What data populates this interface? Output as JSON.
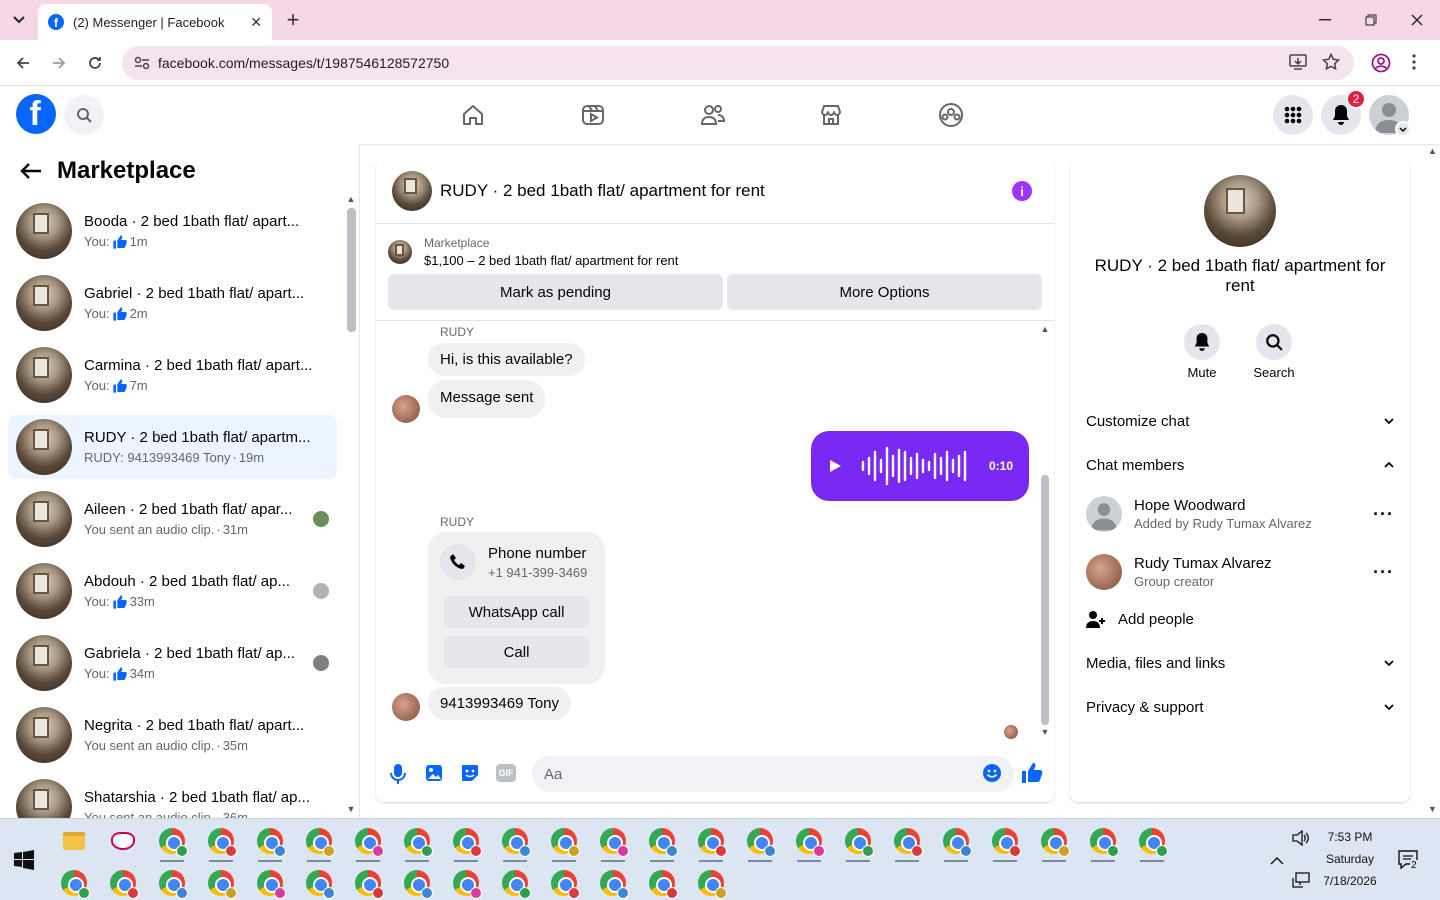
{
  "browser": {
    "tab_title": "(2) Messenger | Facebook",
    "tab_close": "✕",
    "new_tab": "+",
    "url": "facebook.com/messages/t/1987546128572750"
  },
  "fb_header": {
    "notification_count": "2"
  },
  "sidebar": {
    "title": "Marketplace",
    "conversations": [
      {
        "name": "Booda · 2 bed 1bath flat/ apart...",
        "prefix": "You:",
        "like": true,
        "time": "1m",
        "preview": "",
        "active": false
      },
      {
        "name": "Gabriel · 2 bed 1bath flat/ apart...",
        "prefix": "You:",
        "like": true,
        "time": "2m",
        "preview": "",
        "active": false
      },
      {
        "name": "Carmina · 2 bed 1bath flat/ apart...",
        "prefix": "You:",
        "like": true,
        "time": "7m",
        "preview": "",
        "active": false
      },
      {
        "name": "RUDY · 2 bed 1bath flat/ apartm...",
        "prefix": "",
        "like": false,
        "time": "19m",
        "preview": "RUDY: 9413993469 Tony",
        "active": true
      },
      {
        "name": "Aileen · 2 bed 1bath flat/ apar...",
        "prefix": "",
        "like": false,
        "time": "31m",
        "preview": "You sent an audio clip.",
        "active": false
      },
      {
        "name": "Abdouh · 2 bed 1bath flat/ ap...",
        "prefix": "You:",
        "like": true,
        "time": "33m",
        "preview": "",
        "active": false
      },
      {
        "name": "Gabriela · 2 bed 1bath flat/ ap...",
        "prefix": "You:",
        "like": true,
        "time": "34m",
        "preview": "",
        "active": false
      },
      {
        "name": "Negrita · 2 bed 1bath flat/ apart...",
        "prefix": "",
        "like": false,
        "time": "35m",
        "preview": "You sent an audio clip.",
        "active": false
      },
      {
        "name": "Shatarshia · 2 bed 1bath flat/ ap...",
        "prefix": "",
        "like": false,
        "time": "36m",
        "preview": "You sent an audio clip.",
        "active": false
      }
    ]
  },
  "chat": {
    "title": "RUDY · 2 bed 1bath flat/ apartment for rent",
    "marketplace_label": "Marketplace",
    "listing": "$1,100 – 2 bed 1bath flat/ apartment for rent",
    "mark_pending": "Mark as pending",
    "more_options": "More Options",
    "sender1": "RUDY",
    "msg1": "Hi, is this available?",
    "msg2": "Message sent",
    "audio_duration": "0:10",
    "sender2": "RUDY",
    "phone_title": "Phone number",
    "phone_number": "+1 941-399-3469",
    "whatsapp_call": "WhatsApp call",
    "call": "Call",
    "msg3": "9413993469 Tony",
    "input_placeholder": "Aa"
  },
  "details": {
    "title": "RUDY · 2 bed 1bath flat/ apartment for rent",
    "mute": "Mute",
    "search": "Search",
    "customize_chat": "Customize chat",
    "chat_members": "Chat members",
    "members": [
      {
        "name": "Hope Woodward",
        "sub": "Added by Rudy Tumax Alvarez"
      },
      {
        "name": "Rudy Tumax Alvarez",
        "sub": "Group creator"
      }
    ],
    "add_people": "Add people",
    "media": "Media, files and links",
    "privacy": "Privacy & support"
  },
  "taskbar": {
    "time": "7:53 PM",
    "day": "Saturday",
    "date": "7/18/2026",
    "notif_count": "2"
  }
}
